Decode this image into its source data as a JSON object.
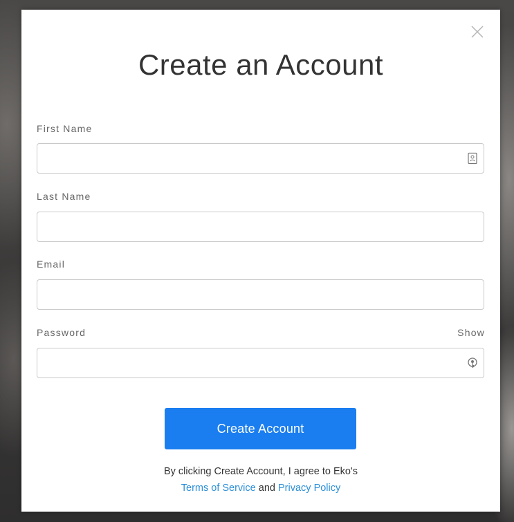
{
  "modal": {
    "title": "Create an Account",
    "close_icon": "close-icon"
  },
  "form": {
    "first_name": {
      "label": "First Name",
      "value": "",
      "icon": "contact-card-icon"
    },
    "last_name": {
      "label": "Last Name",
      "value": ""
    },
    "email": {
      "label": "Email",
      "value": ""
    },
    "password": {
      "label": "Password",
      "value": "",
      "show_label": "Show",
      "icon": "password-key-icon"
    },
    "submit_label": "Create Account"
  },
  "legal": {
    "line1": "By clicking Create Account, I agree to Eko's",
    "terms_label": "Terms of Service",
    "and_text": "and",
    "privacy_label": "Privacy Policy"
  },
  "colors": {
    "accent": "#1a7ef0",
    "link": "#2a8fd8"
  }
}
